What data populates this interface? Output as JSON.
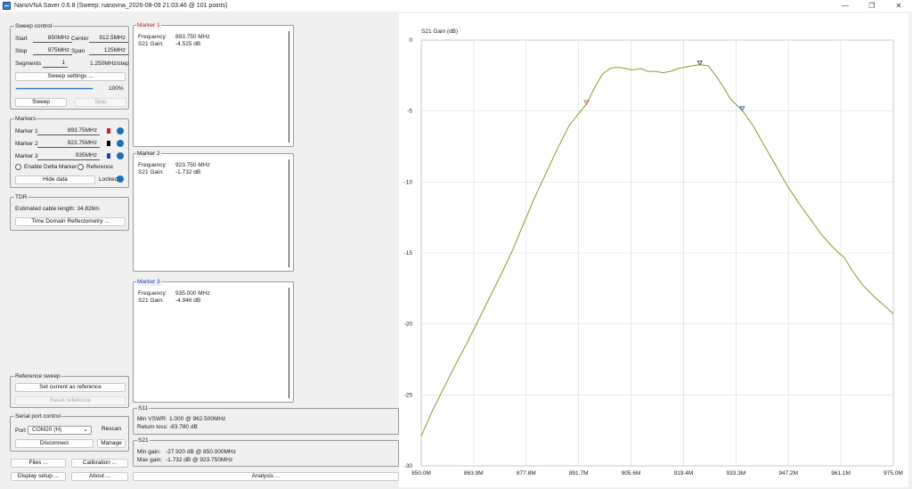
{
  "window": {
    "title": "NanoVNA Saver 0.6.8 (Sweep: nanovna_2026-08-09 21:03:46 @ 101 points)",
    "min": "—",
    "max": "❐",
    "close": "✕"
  },
  "sweep": {
    "title": "Sweep control",
    "start_label": "Start",
    "start_value": "850MHz",
    "center_label": "Center",
    "center_value": "912.5MHz",
    "stop_label": "Stop",
    "stop_value": "975MHz",
    "span_label": "Span",
    "span_value": "125MHz",
    "segments_label": "Segments",
    "segments_value": "1",
    "step_text": "1.250MHz/step",
    "settings_btn": "Sweep settings ...",
    "progress": 100,
    "progress_text": "100%",
    "sweep_btn": "Sweep",
    "stop_btn": "Stop"
  },
  "markers": {
    "title": "Markers",
    "items": [
      {
        "label": "Marker 1",
        "value": "893.75MHz",
        "color": "#d62020"
      },
      {
        "label": "Marker 2",
        "value": "923.75MHz",
        "color": "#000000"
      },
      {
        "label": "Marker 3",
        "value": "935MHz",
        "color": "#1d3fd6"
      }
    ],
    "delta_label": "Enable Delta Marker",
    "reference_label": "Reference",
    "hide_btn": "Hide data",
    "locked_label": "Locked"
  },
  "tdr": {
    "title": "TDR",
    "length_text": "Estimated cable length:  34.826m",
    "btn": "Time Domain Reflectometry ..."
  },
  "reference": {
    "title": "Reference sweep",
    "set_btn": "Set current as reference",
    "reset_btn": "Reset reference"
  },
  "serial": {
    "title": "Serial port control",
    "port_label": "Port",
    "port_value": "COM20 (H)",
    "rescan_btn": "Rescan",
    "disconnect_btn": "Disconnect",
    "manage_btn": "Manage"
  },
  "bottom_btns": {
    "files": "Files ...",
    "calibration": "Calibration ...",
    "display": "Display setup ...",
    "about": "About ..."
  },
  "marker_panels": [
    {
      "title": "Marker 1",
      "title_color": "#d62020",
      "freq_label": "Frequency:",
      "freq_value": "893.750 MHz",
      "gain_label": "S21 Gain:",
      "gain_value": "-4.525 dB"
    },
    {
      "title": "Marker 2",
      "title_color": "#222222",
      "freq_label": "Frequency:",
      "freq_value": "923.750 MHz",
      "gain_label": "S21 Gain:",
      "gain_value": "-1.732 dB"
    },
    {
      "title": "Marker 3",
      "title_color": "#1d3fd6",
      "freq_label": "Frequency:",
      "freq_value": "935.000 MHz",
      "gain_label": "S21 Gain:",
      "gain_value": "-4.946 dB"
    }
  ],
  "s11": {
    "title": "S11",
    "vswr_label": "Min VSWR:",
    "vswr_value": "1.000 @ 962.500MHz",
    "rl_label": "Return loss:",
    "rl_value": "-83.780 dB"
  },
  "s21": {
    "title": "S21",
    "min_label": "Min gain:",
    "min_value": "-27.920 dB @ 850.000MHz",
    "max_label": "Max gain:",
    "max_value": "-1.732 dB @ 923.750MHz"
  },
  "analysis_btn": "Analysis ...",
  "chart_data": {
    "type": "line",
    "title": "S21 Gain (dB)",
    "xlabel": "",
    "ylabel": "",
    "xlim": [
      850.0,
      975.0
    ],
    "ylim": [
      -30,
      0
    ],
    "xticks": [
      "850.0M",
      "863.9M",
      "877.8M",
      "891.7M",
      "905.6M",
      "919.4M",
      "933.3M",
      "947.2M",
      "961.1M",
      "975.0M"
    ],
    "yticks": [
      "0",
      "-5",
      "-10",
      "-15",
      "-20",
      "-25",
      "-30"
    ],
    "grid": true,
    "line_color": "#8a9a2a",
    "series": [
      {
        "x": [
          850,
          853,
          856,
          859,
          862,
          865,
          868,
          871,
          874,
          877,
          880,
          883,
          886,
          889,
          891,
          893.75,
          896,
          898,
          900,
          902,
          904,
          906,
          908,
          910,
          912,
          914,
          916,
          918,
          920,
          922,
          923.75,
          926,
          928,
          930,
          932,
          935,
          938,
          941,
          944,
          947,
          950,
          953,
          956,
          959,
          961,
          962,
          964,
          967,
          970,
          973,
          975
        ],
        "y": [
          -27.9,
          -26.1,
          -24.5,
          -22.9,
          -21.4,
          -19.8,
          -18.2,
          -16.6,
          -14.9,
          -13.0,
          -11.1,
          -9.4,
          -7.7,
          -6.1,
          -5.4,
          -4.5,
          -3.3,
          -2.4,
          -2.0,
          -1.9,
          -2.0,
          -2.1,
          -2.0,
          -2.2,
          -2.2,
          -2.3,
          -2.2,
          -2.0,
          -1.9,
          -1.8,
          -1.73,
          -1.8,
          -2.5,
          -3.3,
          -4.2,
          -4.95,
          -6.1,
          -7.5,
          -8.9,
          -10.3,
          -11.5,
          -12.6,
          -13.7,
          -14.6,
          -15.1,
          -15.3,
          -16.2,
          -17.3,
          -18.1,
          -18.8,
          -19.3
        ]
      }
    ],
    "markers": [
      {
        "x": 893.75,
        "y": -4.525,
        "color": "#d65a3a"
      },
      {
        "x": 923.75,
        "y": -1.732,
        "color": "#444444"
      },
      {
        "x": 935.0,
        "y": -4.946,
        "color": "#2a4fd0"
      }
    ]
  }
}
